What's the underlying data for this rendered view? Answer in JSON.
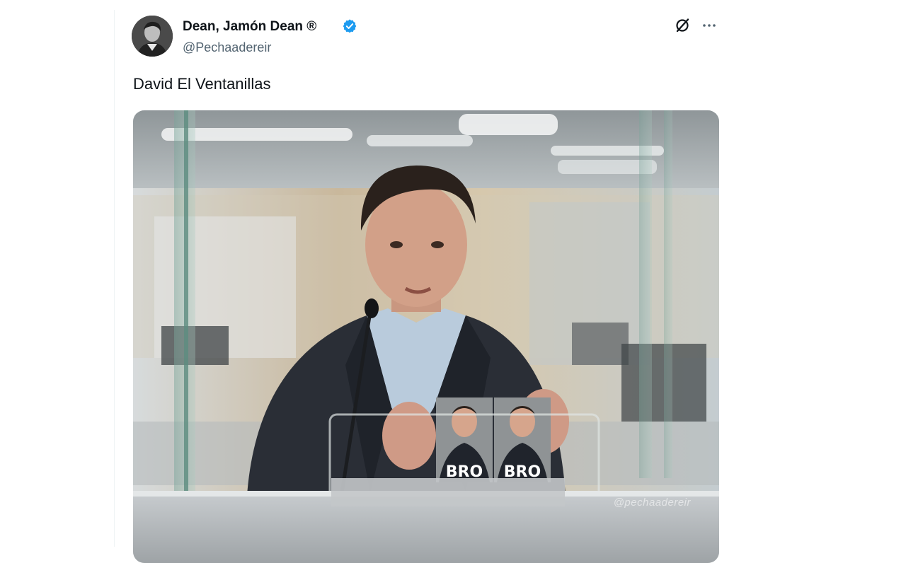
{
  "tweet": {
    "display_name": "Dean, Jamón Dean ®",
    "handle": "@Pechaadereir",
    "text": "David El Ventanillas",
    "verified_icon": "verified-badge-icon",
    "grok_icon": "grok-icon",
    "more_icon": "more-options-icon"
  },
  "media": {
    "photo_labels": [
      "BRO",
      "BRO"
    ],
    "watermark": "@pechaadereir"
  },
  "colors": {
    "verified_blue": "#1d9bf0",
    "secondary_text": "#536471",
    "primary_text": "#0f1419"
  }
}
